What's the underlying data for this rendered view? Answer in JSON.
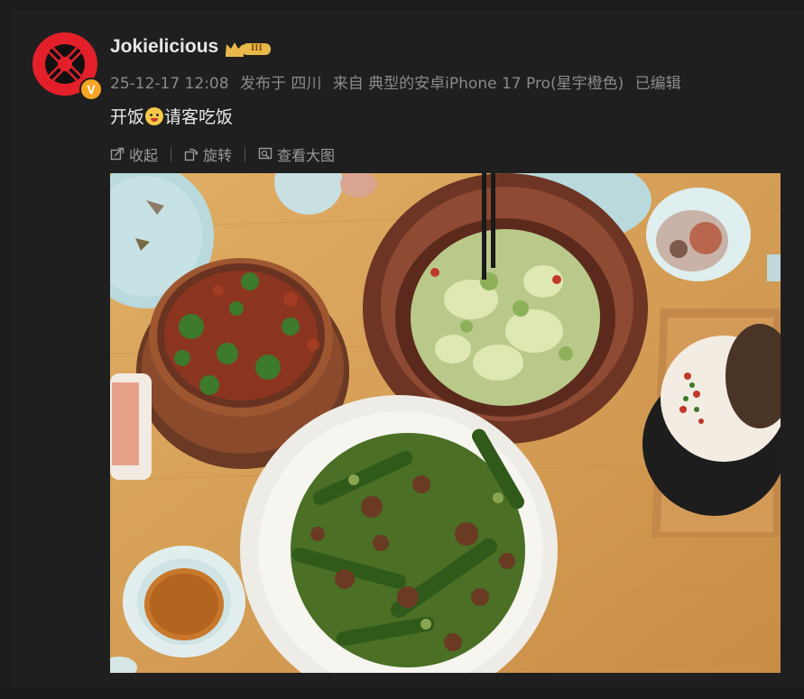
{
  "post": {
    "username": "Jokielicious",
    "rank_label": "III",
    "verified_label": "V",
    "date": "25-12-17 12:08",
    "published_in": "发布于 四川",
    "source": "来自 典型的安卓iPhone 17 Pro(星宇橙色)",
    "edited": "已编辑",
    "text_before": "开饭",
    "text_after": "请客吃饭",
    "emoji": "grin-sweat-emoji"
  },
  "toolbar": {
    "collapse_label": "收起",
    "rotate_label": "旋转",
    "view_large_label": "查看大图"
  },
  "colors": {
    "background": "#1f1f1f",
    "text_primary": "#e6e6e6",
    "text_meta": "#8a8a8a",
    "avatar_red": "#e3202a",
    "verified_orange": "#f5a623",
    "badge_gold": "#e9b84a"
  }
}
